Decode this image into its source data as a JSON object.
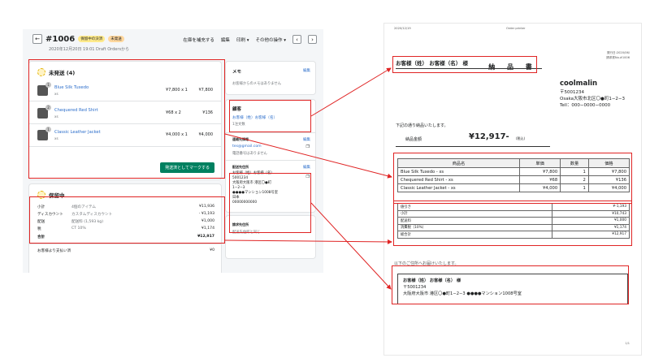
{
  "order": {
    "number": "#1006",
    "badge_payment": "保留中の決済",
    "badge_fulfillment": "未発送",
    "subtitle": "2020年12月20日 19:01 Draft Ordersから",
    "actions": [
      "在庫を補充する",
      "編集",
      "印刷",
      "その他の操作"
    ]
  },
  "unfulfilled": {
    "title": "未発送 (4)",
    "items": [
      {
        "name": "Blue Silk Tuxedo",
        "variant": "xs",
        "qty": "1",
        "price": "¥7,800 x 1",
        "total": "¥7,800"
      },
      {
        "name": "Chequered Red Shirt",
        "variant": "xs",
        "qty": "2",
        "price": "¥68 x 2",
        "total": "¥136"
      },
      {
        "name": "Classic Leather Jacket",
        "variant": "xs",
        "qty": "1",
        "price": "¥4,000 x 1",
        "total": "¥4,000"
      }
    ],
    "button": "発送済としてマークする"
  },
  "payment": {
    "title": "保留中",
    "rows": [
      {
        "label": "小計",
        "mid": "4個のアイテム",
        "value": "¥11,936"
      },
      {
        "label": "ディスカウント",
        "mid": "カスタムディスカウント",
        "value": "- ¥1,193"
      },
      {
        "label": "配送",
        "mid": "配送料 (1,593 kg)",
        "value": "¥1,000"
      },
      {
        "label": "税",
        "mid": "CT 10%",
        "value": "¥1,174"
      },
      {
        "label": "合計",
        "mid": "",
        "value": "¥12,917"
      }
    ],
    "paid_label": "お客様より支払い済",
    "paid_value": "¥0"
  },
  "sidebar": {
    "memo_title": "メモ",
    "memo_edit": "編集",
    "memo_text": "お客様からのメモはありません",
    "customer_title": "顧客",
    "customer_name": "お客様（姓）お客様（名）",
    "customer_orders": "1注文数",
    "contact_title": "連絡先情報",
    "contact_edit": "編集",
    "contact_email": "tes@gmail.com",
    "contact_phone": "電話番号はありません",
    "shipping_title": "配送先住所",
    "shipping_edit": "編集",
    "shipping_lines": [
      "お客様（姓）お客様（名）",
      "5001234",
      "大阪府大阪市 港区〇●町",
      "1−2−3",
      "●●●●マンション1008号室",
      "日本",
      "00000000000"
    ],
    "billing_title": "請求先住所",
    "billing_text": "配送先住所と同じ"
  },
  "invoice": {
    "header_date": "2020/12/19",
    "header_app": "Order printer",
    "title": "納 品 書",
    "issue_date": "発行日:2020/06/",
    "invoice_no": "請求書No.#1006",
    "dear": "お客様（姓） お客様（名） 様",
    "company": "coolmalin",
    "company_info": [
      "〒5001234",
      "Osaka大阪市北区〇●町1−2−3",
      "Tell：000−0000−0000"
    ],
    "thanks": "下記の通り納品いたします。",
    "amount_label": "納品金額",
    "amount": "¥12,917-",
    "tax_note": "(税込)",
    "headers": [
      "商品名",
      "単価",
      "数量",
      "価格"
    ],
    "rows": [
      [
        "Blue Silk Tuxedo - xs",
        "¥7,800",
        "1",
        "¥7,800"
      ],
      [
        "Chequered Red Shirt - xs",
        "¥68",
        "2",
        "¥136"
      ],
      [
        "Classic Leather Jacket - xs",
        "¥4,000",
        "1",
        "¥4,000"
      ]
    ],
    "totals": [
      [
        "値引き",
        "¥-1,193"
      ],
      [
        "小計",
        "¥10,743"
      ],
      [
        "配送料",
        "¥1,000"
      ],
      [
        "消費税（10%）",
        "¥1,174"
      ],
      [
        "総合計",
        "¥12,917"
      ]
    ],
    "ship_heading": "以下のご住所へお届けいたします。",
    "ship_name": "お客様（姓） お客様（名） 様",
    "ship_zip": "〒5001234",
    "ship_address": "大阪府大阪市 港区〇●町1−2−3 ●●●●マンション1008号室",
    "page": "1/1"
  }
}
